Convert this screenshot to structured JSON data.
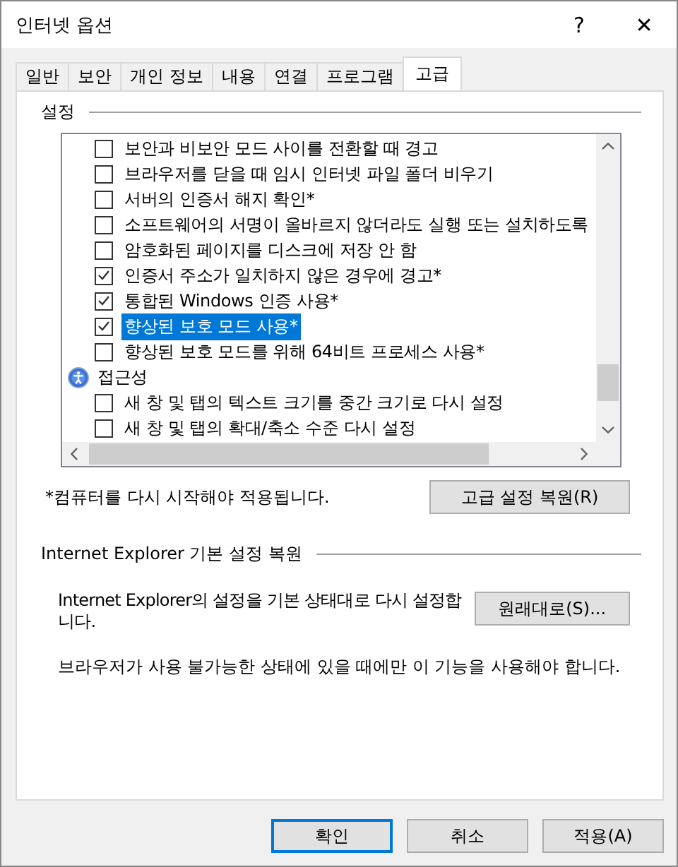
{
  "window": {
    "title": "인터넷 옵션",
    "help": "?",
    "close": "✕"
  },
  "tabs": [
    {
      "label": "일반",
      "selected": false
    },
    {
      "label": "보안",
      "selected": false
    },
    {
      "label": "개인 정보",
      "selected": false
    },
    {
      "label": "내용",
      "selected": false
    },
    {
      "label": "연결",
      "selected": false
    },
    {
      "label": "프로그램",
      "selected": false
    },
    {
      "label": "고급",
      "selected": true
    }
  ],
  "settings": {
    "title": "설정",
    "items": [
      {
        "kind": "checkbox",
        "label": "보안과 비보안 모드 사이를 전환할 때 경고",
        "checked": false,
        "selected": false
      },
      {
        "kind": "checkbox",
        "label": "브라우저를 닫을 때 임시 인터넷 파일 폴더 비우기",
        "checked": false,
        "selected": false
      },
      {
        "kind": "checkbox",
        "label": "서버의 인증서 해지 확인*",
        "checked": false,
        "selected": false
      },
      {
        "kind": "checkbox",
        "label": "소프트웨어의 서명이 올바르지 않더라도 실행 또는 설치하도록",
        "checked": false,
        "selected": false
      },
      {
        "kind": "checkbox",
        "label": "암호화된 페이지를 디스크에 저장 안 함",
        "checked": false,
        "selected": false
      },
      {
        "kind": "checkbox",
        "label": "인증서 주소가 일치하지 않은 경우에 경고*",
        "checked": true,
        "selected": false
      },
      {
        "kind": "checkbox",
        "label": "통합된 Windows 인증 사용*",
        "checked": true,
        "selected": false
      },
      {
        "kind": "checkbox",
        "label": "향상된 보호 모드 사용*",
        "checked": true,
        "selected": true
      },
      {
        "kind": "checkbox",
        "label": "향상된 보호 모드를 위해 64비트 프로세스 사용*",
        "checked": false,
        "selected": false
      },
      {
        "kind": "category",
        "label": "접근성",
        "selected": false
      },
      {
        "kind": "checkbox",
        "label": "새 창 및 탭의 텍스트 크기를 중간 크기로 다시 설정",
        "checked": false,
        "selected": false
      },
      {
        "kind": "checkbox",
        "label": "새 창 및 탭의 확대/축소 수준 다시 설정",
        "checked": false,
        "selected": false
      }
    ],
    "note": "*컴퓨터를 다시 시작해야 적용됩니다.",
    "restore_button": "고급 설정 복원(R)"
  },
  "reset": {
    "title": "Internet Explorer 기본 설정 복원",
    "description": "Internet Explorer의 설정을 기본 상태대로 다시 설정합니다.",
    "button": "원래대로(S)...",
    "warning": "브라우저가 사용 불가능한 상태에 있을 때에만 이 기능을 사용해야 합니다."
  },
  "buttons": [
    {
      "label": "확인",
      "default": true
    },
    {
      "label": "취소",
      "default": false
    },
    {
      "label": "적용(A)",
      "default": false
    }
  ]
}
